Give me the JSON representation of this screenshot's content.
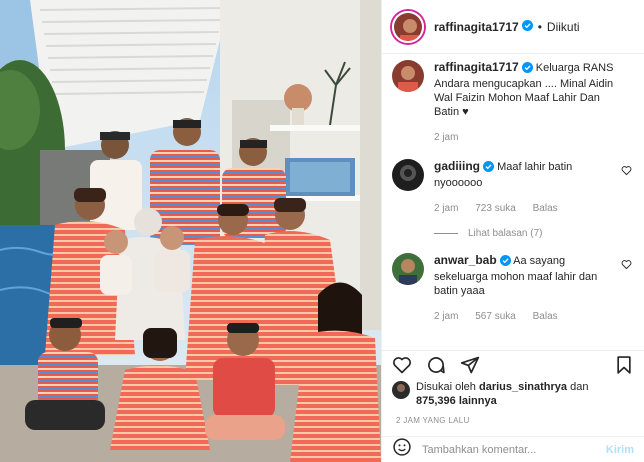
{
  "post": {
    "image_alt": "Family photo of Keluarga RANS in matching striped outfits"
  },
  "header": {
    "username": "raffinagita1717",
    "separator": "•",
    "follow_status": "Diikuti"
  },
  "caption": {
    "username": "raffinagita1717",
    "text": "Keluarga RANS Andara mengucapkan .... Minal Aidin Wal Faizin Mohon Maaf Lahir Dan Batin ♥",
    "time": "2 jam"
  },
  "comments": [
    {
      "username": "gadiiing",
      "text": "Maaf lahir batin nyoooooo",
      "time": "2 jam",
      "likes": "723 suka",
      "reply": "Balas"
    },
    {
      "username": "anwar_bab",
      "text": "Aa sayang sekeluarga mohon maaf lahir dan batin yaaa",
      "time": "2 jam",
      "likes": "567 suka",
      "reply": "Balas"
    }
  ],
  "view_replies": "Lihat balasan (7)",
  "likes": {
    "prefix": "Disukai oleh",
    "user": "darius_sinathrya",
    "conjunction": "dan",
    "others": "875,396 lainnya"
  },
  "timestamp": "2 JAM YANG LALU",
  "comment_box": {
    "placeholder": "Tambahkan komentar...",
    "post_label": "Kirim"
  },
  "colors": {
    "accent": "#0095f6",
    "accent_disabled": "#b2dffc",
    "text": "#262626",
    "muted": "#8e8e8e",
    "border": "#efefef"
  },
  "icons": [
    "heart-icon",
    "comment-icon",
    "share-icon",
    "bookmark-icon",
    "emoji-icon",
    "verified-badge-icon"
  ]
}
